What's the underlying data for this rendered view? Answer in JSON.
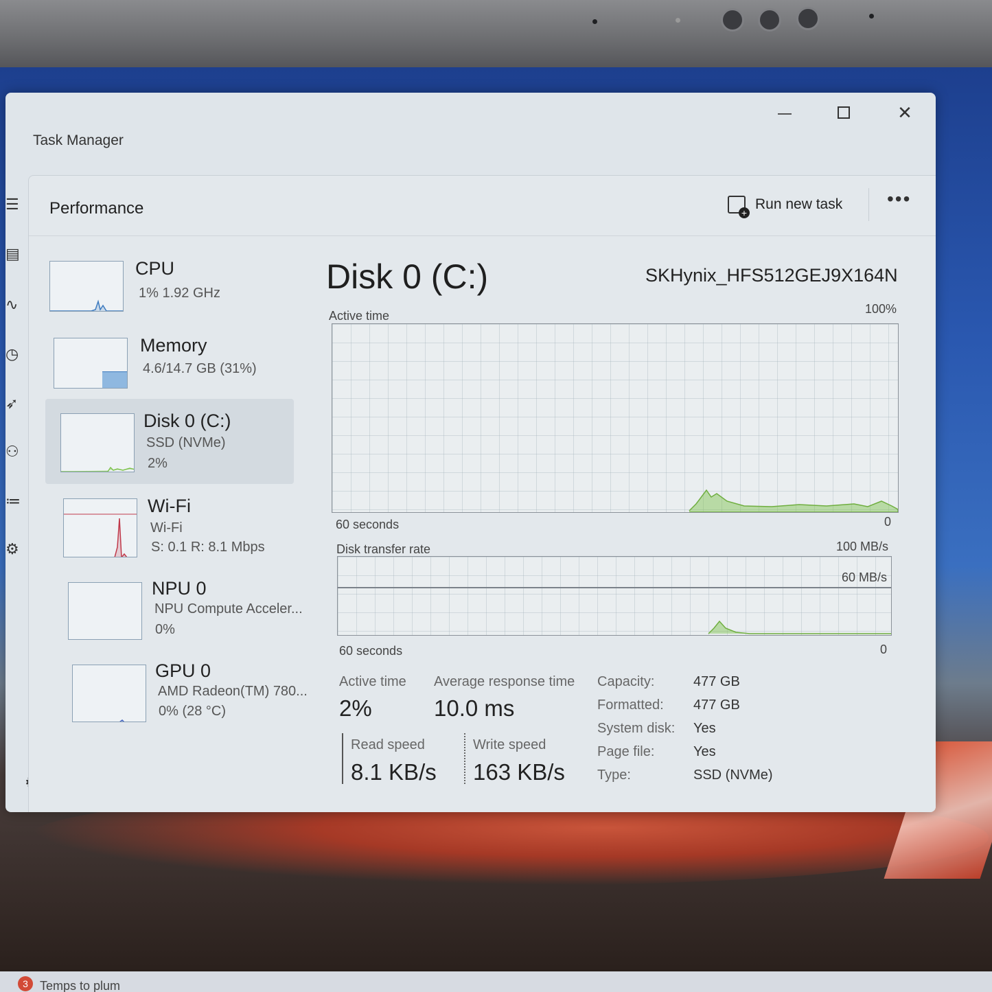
{
  "window": {
    "title": "Task Manager"
  },
  "header": {
    "title": "Performance",
    "run_task_label": "Run new task"
  },
  "devices": [
    {
      "name": "CPU",
      "line1": "1%  1.92 GHz",
      "line2": ""
    },
    {
      "name": "Memory",
      "line1": "4.6/14.7 GB (31%)",
      "line2": ""
    },
    {
      "name": "Disk 0 (C:)",
      "line1": "SSD (NVMe)",
      "line2": "2%"
    },
    {
      "name": "Wi-Fi",
      "line1": "Wi-Fi",
      "line2": "S: 0.1  R: 8.1 Mbps"
    },
    {
      "name": "NPU 0",
      "line1": "NPU Compute Acceler...",
      "line2": "0%"
    },
    {
      "name": "GPU 0",
      "line1": "AMD Radeon(TM) 780...",
      "line2": "0%  (28 °C)"
    }
  ],
  "detail": {
    "title": "Disk 0 (C:)",
    "model": "SKHynix_HFS512GEJ9X164N",
    "active_graph": {
      "label": "Active time",
      "max": "100%",
      "span": "60 seconds",
      "min": "0"
    },
    "transfer_graph": {
      "label": "Disk transfer rate",
      "max": "100 MB/s",
      "mid": "60 MB/s",
      "span": "60 seconds",
      "min": "0"
    },
    "stats": {
      "active_time_label": "Active time",
      "active_time_value": "2%",
      "avg_resp_label": "Average response time",
      "avg_resp_value": "10.0 ms",
      "read_label": "Read speed",
      "read_value": "8.1 KB/s",
      "write_label": "Write speed",
      "write_value": "163 KB/s"
    },
    "properties": [
      {
        "key": "Capacity:",
        "value": "477 GB"
      },
      {
        "key": "Formatted:",
        "value": "477 GB"
      },
      {
        "key": "System disk:",
        "value": "Yes"
      },
      {
        "key": "Page file:",
        "value": "Yes"
      },
      {
        "key": "Type:",
        "value": "SSD (NVMe)"
      }
    ]
  },
  "taskbar": {
    "badge": "3",
    "item": "Temps to plum"
  },
  "colors": {
    "disk_graph": "#7cc24a",
    "cpu_graph": "#3d7bbf",
    "memory_fill": "#8fb8e0",
    "wifi_graph": "#c0394a",
    "accent": "#1f1f1f"
  },
  "icons": [
    "hamburger-menu-icon",
    "processes-icon",
    "performance-icon",
    "app-history-icon",
    "startup-apps-icon",
    "users-icon",
    "details-icon",
    "services-icon",
    "settings-icon",
    "run-new-task-icon",
    "more-options-icon",
    "minimize-icon",
    "maximize-icon",
    "close-icon"
  ]
}
